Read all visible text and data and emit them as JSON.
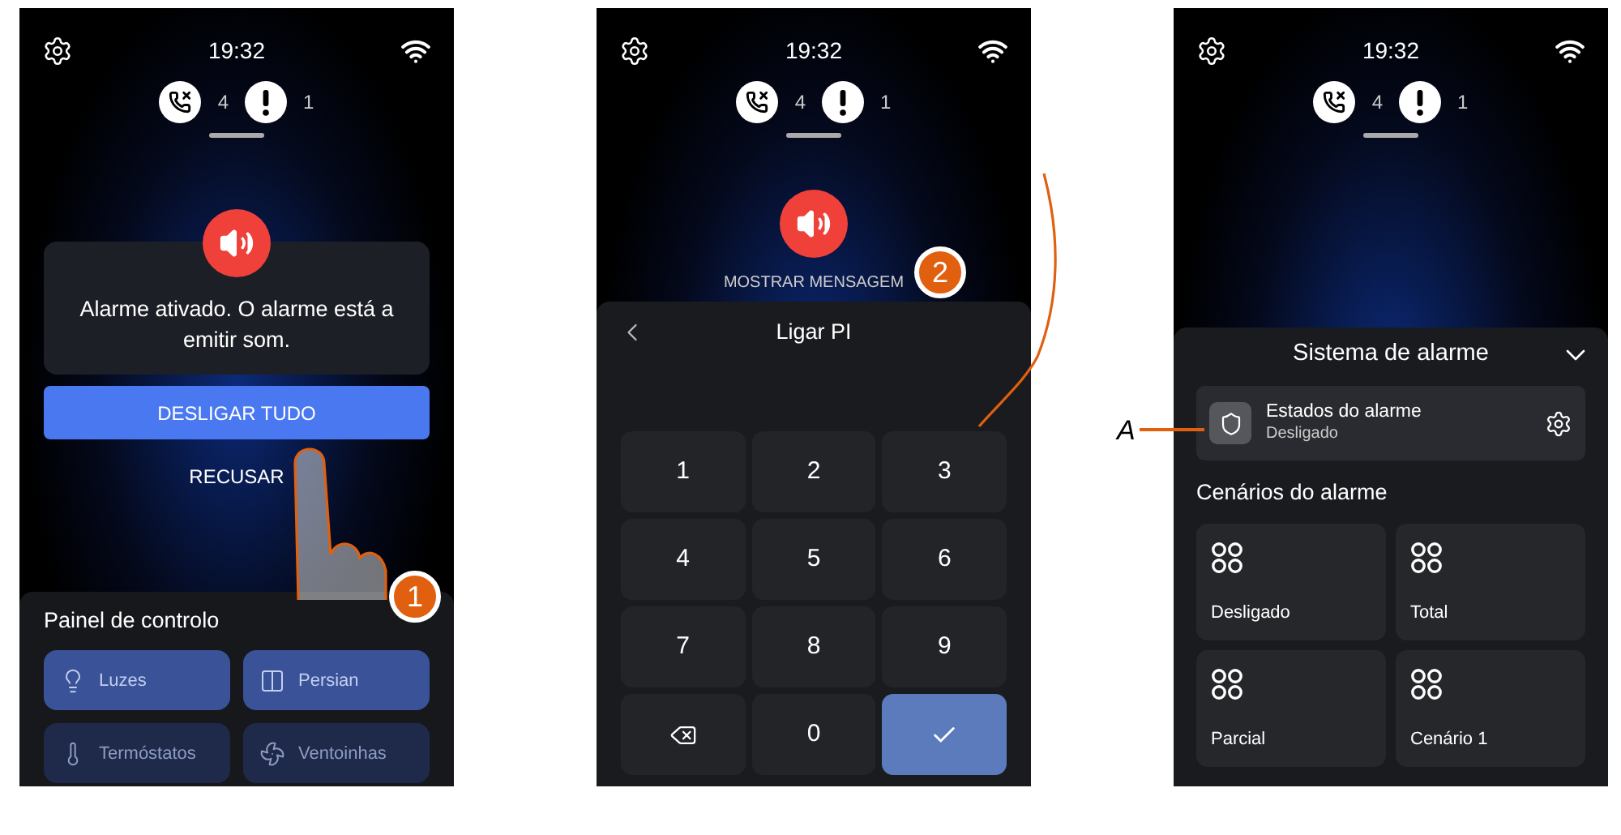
{
  "screens": [
    {
      "status": {
        "time": "19:32",
        "missed_calls": "4",
        "alerts": "1"
      },
      "alert": {
        "message": "Alarme ativado. O alarme está a emitir som.",
        "primary_button": "DESLIGAR TUDO",
        "secondary_button": "RECUSAR"
      },
      "panel": {
        "title": "Painel de controlo",
        "tiles": [
          {
            "kind": "bulb",
            "label": "Luzes"
          },
          {
            "kind": "shutter",
            "label": "Persian"
          },
          {
            "kind": "thermostat",
            "label": "Termóstatos"
          },
          {
            "kind": "fan",
            "label": "Ventoinhas"
          }
        ]
      },
      "callout": "1"
    },
    {
      "status": {
        "time": "19:32",
        "missed_calls": "4",
        "alerts": "1"
      },
      "alarm_button": {
        "label": "MOSTRAR MENSAGEM"
      },
      "pin_panel": {
        "title": "Ligar PI",
        "keys": [
          {
            "kind": "digit",
            "label": "1"
          },
          {
            "kind": "digit",
            "label": "2"
          },
          {
            "kind": "digit",
            "label": "3"
          },
          {
            "kind": "digit",
            "label": "4"
          },
          {
            "kind": "digit",
            "label": "5"
          },
          {
            "kind": "digit",
            "label": "6"
          },
          {
            "kind": "digit",
            "label": "7"
          },
          {
            "kind": "digit",
            "label": "8"
          },
          {
            "kind": "digit",
            "label": "9"
          },
          {
            "kind": "backspace"
          },
          {
            "kind": "digit",
            "label": "0"
          },
          {
            "kind": "confirm"
          }
        ]
      },
      "callout": "2"
    },
    {
      "status": {
        "time": "19:32",
        "missed_calls": "4",
        "alerts": "1"
      },
      "alarm_sheet": {
        "title": "Sistema de alarme",
        "state_card": {
          "title": "Estados do alarme",
          "value": "Desligado",
          "annotation": "A"
        },
        "section_title": "Cenários do alarme",
        "scenarios": [
          {
            "label": "Desligado"
          },
          {
            "label": "Total"
          },
          {
            "label": "Parcial"
          },
          {
            "label": "Cenário 1"
          }
        ]
      }
    }
  ]
}
